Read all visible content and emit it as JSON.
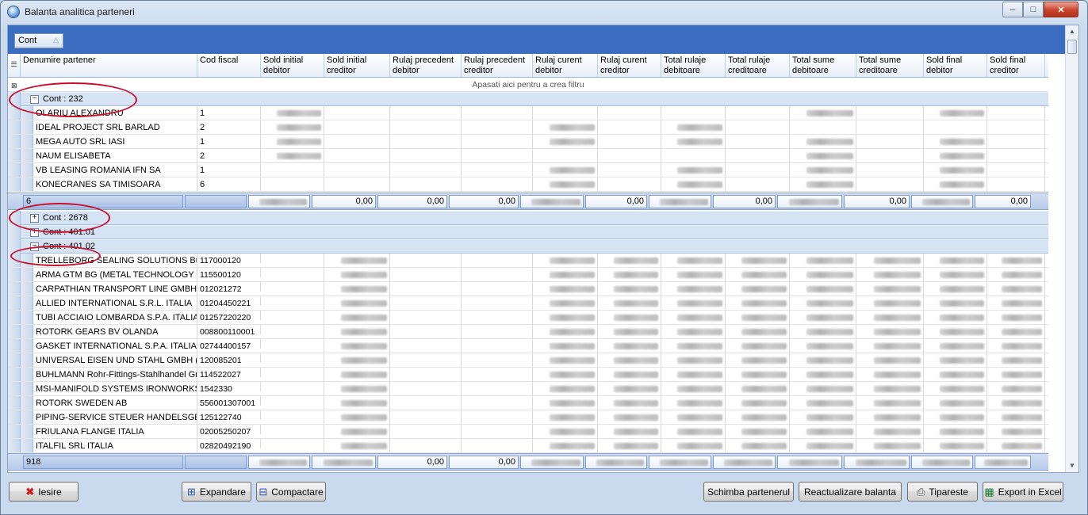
{
  "window": {
    "title": "Balanta analitica parteneri",
    "min": "‒",
    "max": "□",
    "close": "✕"
  },
  "groupbar": {
    "chip_label": "Cont"
  },
  "filter_text": "Apasati aici pentru a  crea filtru",
  "columns": [
    "Denumire partener",
    "Cod fiscal",
    "Sold initial debitor",
    "Sold initial creditor",
    "Rulaj precedent debitor",
    "Rulaj precedent creditor",
    "Rulaj curent debitor",
    "Rulaj curent creditor",
    "Total rulaje debitoare",
    "Total rulaje creditoare",
    "Total sume debitoare",
    "Total sume creditoare",
    "Sold final debitor",
    "Sold final creditor"
  ],
  "groups": [
    {
      "label": "Cont : 232",
      "toggle": "−",
      "rows": [
        {
          "name": "OLARIU ALEXANDRU",
          "cod": "1"
        },
        {
          "name": "IDEAL PROJECT SRL BARLAD",
          "cod": "2"
        },
        {
          "name": "MEGA AUTO SRL IASI",
          "cod": "1"
        },
        {
          "name": "NAUM ELISABETA",
          "cod": "2"
        },
        {
          "name": "VB LEASING ROMANIA IFN SA",
          "cod": "1"
        },
        {
          "name": "KONECRANES SA TIMISOARA",
          "cod": "6"
        }
      ],
      "summary": {
        "count": "6",
        "values": [
          "",
          "0,00",
          "0,00",
          "0,00",
          "",
          "0,00",
          "",
          "0,00",
          "",
          "0,00",
          "",
          "0,00"
        ]
      }
    },
    {
      "label": "Cont : 2678",
      "toggle": "+"
    },
    {
      "label": "Cont : 401.01",
      "toggle": "+"
    },
    {
      "label": "Cont : 401.02",
      "toggle": "−",
      "rows": [
        {
          "name": "TRELLEBORG SEALING SOLUTIONS Bul",
          "cod": "117000120"
        },
        {
          "name": "ARMA GTM BG  (METAL TECHNOLOGY (",
          "cod": "115500120"
        },
        {
          "name": "CARPATHIAN TRANSPORT LINE GMBH",
          "cod": "012021272"
        },
        {
          "name": "ALLIED INTERNATIONAL S.R.L. ITALIA",
          "cod": "01204450221"
        },
        {
          "name": "TUBI ACCIAIO LOMBARDA S.P.A. ITALIA",
          "cod": "01257220220"
        },
        {
          "name": "ROTORK GEARS BV OLANDA",
          "cod": "008800110001"
        },
        {
          "name": "GASKET INTERNATIONAL S.P.A. ITALIA",
          "cod": "02744400157"
        },
        {
          "name": "UNIVERSAL EISEN UND STAHL GMBH (",
          "cod": "120085201"
        },
        {
          "name": "BUHLMANN Rohr-Fittings-Stahlhandel Gmb",
          "cod": "114522027"
        },
        {
          "name": "MSI-MANIFOLD SYSTEMS IRONWORKS",
          "cod": "1542330"
        },
        {
          "name": "ROTORK SWEDEN AB",
          "cod": "556001307001"
        },
        {
          "name": "PIPING-SERVICE STEUER HANDELSGES",
          "cod": "125122740"
        },
        {
          "name": "FRIULANA FLANGE ITALIA",
          "cod": "02005250207"
        },
        {
          "name": "ITALFIL SRL ITALIA",
          "cod": "02820492190"
        }
      ],
      "summary": {
        "count": "918",
        "values": [
          "",
          "",
          "0,00",
          "0,00",
          "",
          "",
          "",
          "",
          "",
          "",
          "",
          ""
        ]
      }
    }
  ],
  "buttons": {
    "iesire": "Iesire",
    "expandare": "Expandare",
    "compactare": "Compactare",
    "schimba": "Schimba partenerul",
    "reactualizare": "Reactualizare balanta",
    "tipareste": "Tipareste",
    "export": "Export in Excel"
  }
}
